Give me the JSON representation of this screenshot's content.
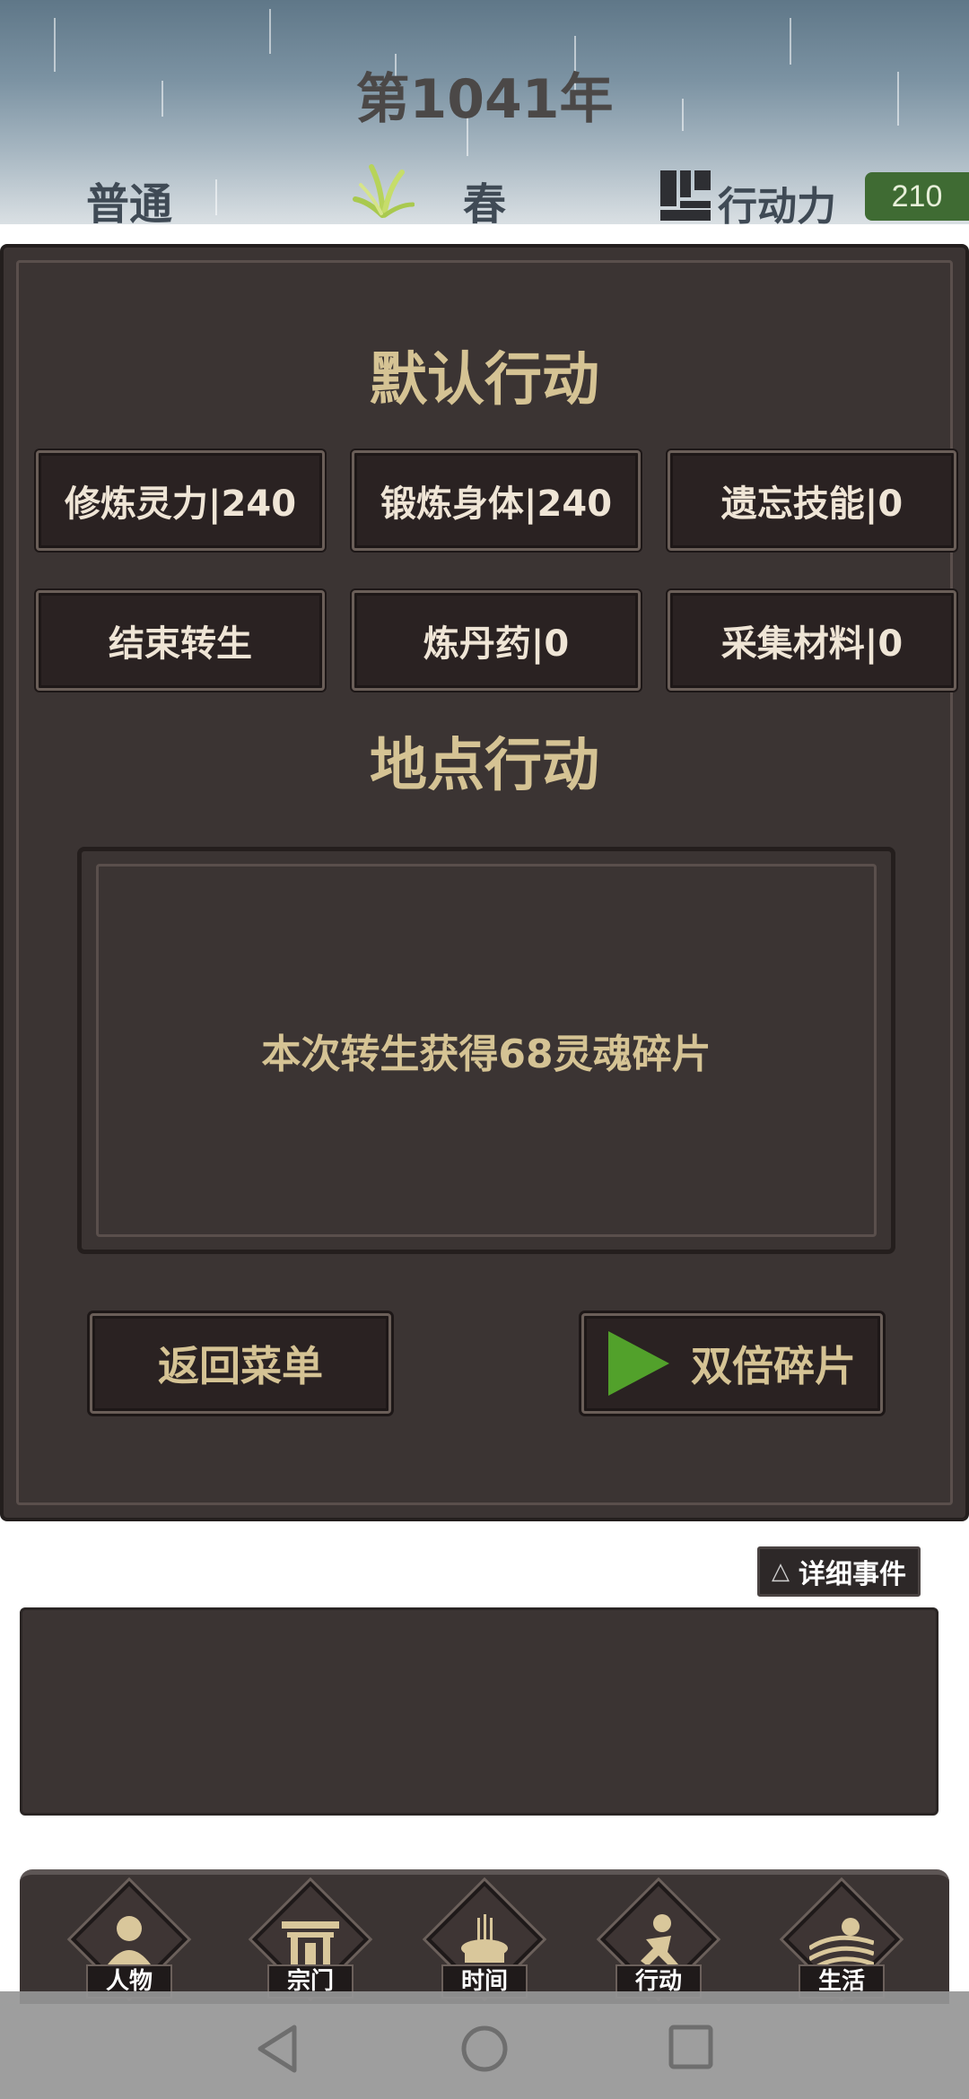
{
  "header": {
    "year_title": "第1041年",
    "difficulty": "普通",
    "season": "春",
    "action_points_label": "行动力",
    "action_points_value": "210",
    "season_icon": "grass-sprout-icon",
    "action_points_icon": "blocks-icon"
  },
  "default_actions": {
    "title": "默认行动",
    "buttons": [
      {
        "label": "修炼灵力|240"
      },
      {
        "label": "锻炼身体|240"
      },
      {
        "label": "遗忘技能|0"
      },
      {
        "label": "结束转生"
      },
      {
        "label": "炼丹药|0"
      },
      {
        "label": "采集材料|0"
      }
    ]
  },
  "location_actions": {
    "title": "地点行动",
    "info_text": "本次转生获得68灵魂碎片"
  },
  "controls": {
    "back_label": "返回菜单",
    "double_label": "双倍碎片",
    "double_icon": "play-icon"
  },
  "events": {
    "detail_label": "详细事件",
    "detail_icon": "triangle-icon"
  },
  "bottom_nav": {
    "items": [
      {
        "label": "人物",
        "icon": "person-icon"
      },
      {
        "label": "宗门",
        "icon": "gate-icon"
      },
      {
        "label": "时间",
        "icon": "incense-icon"
      },
      {
        "label": "行动",
        "icon": "running-person-icon"
      },
      {
        "label": "生活",
        "icon": "landscape-icon"
      }
    ]
  },
  "colors": {
    "panel": "#3b3433",
    "gold_text": "#d5c394",
    "ap_badge": "#3f6b33",
    "play_green": "#52a12b"
  }
}
